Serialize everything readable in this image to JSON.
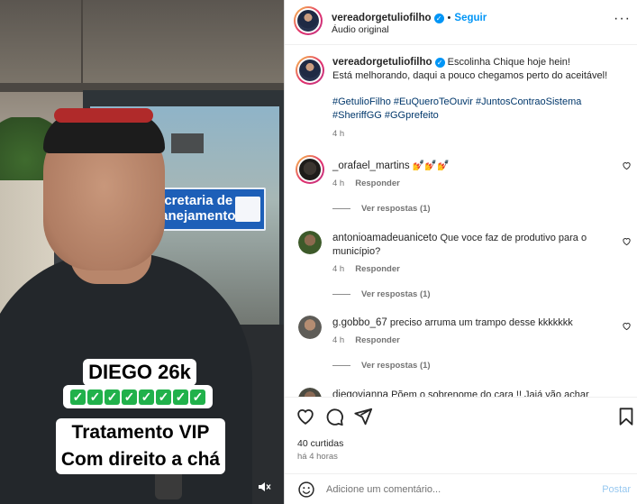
{
  "media": {
    "sign_text": "ecretaria de\nlanejamento",
    "caption_line1": "DIEGO 26k",
    "caption_checks": "✅✅✅✅✅✅✅✅",
    "caption_line2": "Tratamento VIP",
    "caption_line3": "Com direito a chá",
    "mute_icon": "speaker-muted-icon"
  },
  "header": {
    "username": "vereadorgetuliofilho",
    "follow_label": "Seguir",
    "subline": "Áudio original",
    "dot": "•",
    "more_label": "···"
  },
  "post_caption": {
    "username": "vereadorgetuliofilho",
    "text_line1": "Escolinha Chique hoje hein!",
    "text_line2": "Está melhorando, daqui a pouco chegamos perto do aceitável!",
    "hashtags_line1": "#GetulioFilho #EuQueroTeOuvir #JuntosContraoSistema",
    "hashtags_line2": "#SheriffGG #GGprefeito",
    "time": "4 h"
  },
  "comments": [
    {
      "username": "_orafael_martins",
      "text": "💅💅💅",
      "time": "4 h",
      "reply_label": "Responder",
      "replies_label": "Ver respostas (1)"
    },
    {
      "username": "antonioamadeuaniceto",
      "text": "Que voce faz de produtivo para o município?",
      "time": "4 h",
      "reply_label": "Responder",
      "replies_label": "Ver respostas (1)"
    },
    {
      "username": "g.gobbo_67",
      "text": "preciso arruma um trampo desse kkkkkkk",
      "time": "4 h",
      "reply_label": "Responder",
      "replies_label": "Ver respostas (1)"
    },
    {
      "username": "diegovianna",
      "text": "Põem o sobrenome do cara !! Jajá vão achar",
      "time": "",
      "reply_label": "",
      "replies_label": ""
    }
  ],
  "actions": {
    "likes": "40 curtidas",
    "date": "há 4 horas"
  },
  "composer": {
    "placeholder": "Adicione um comentário...",
    "post_label": "Postar"
  },
  "colors": {
    "link_blue": "#0095f6",
    "hashtag_blue": "#00376b",
    "muted_text": "#737373",
    "post_disabled": "#97c8f0",
    "sign_blue": "#1d5fb8",
    "check_green": "#21b14b"
  }
}
